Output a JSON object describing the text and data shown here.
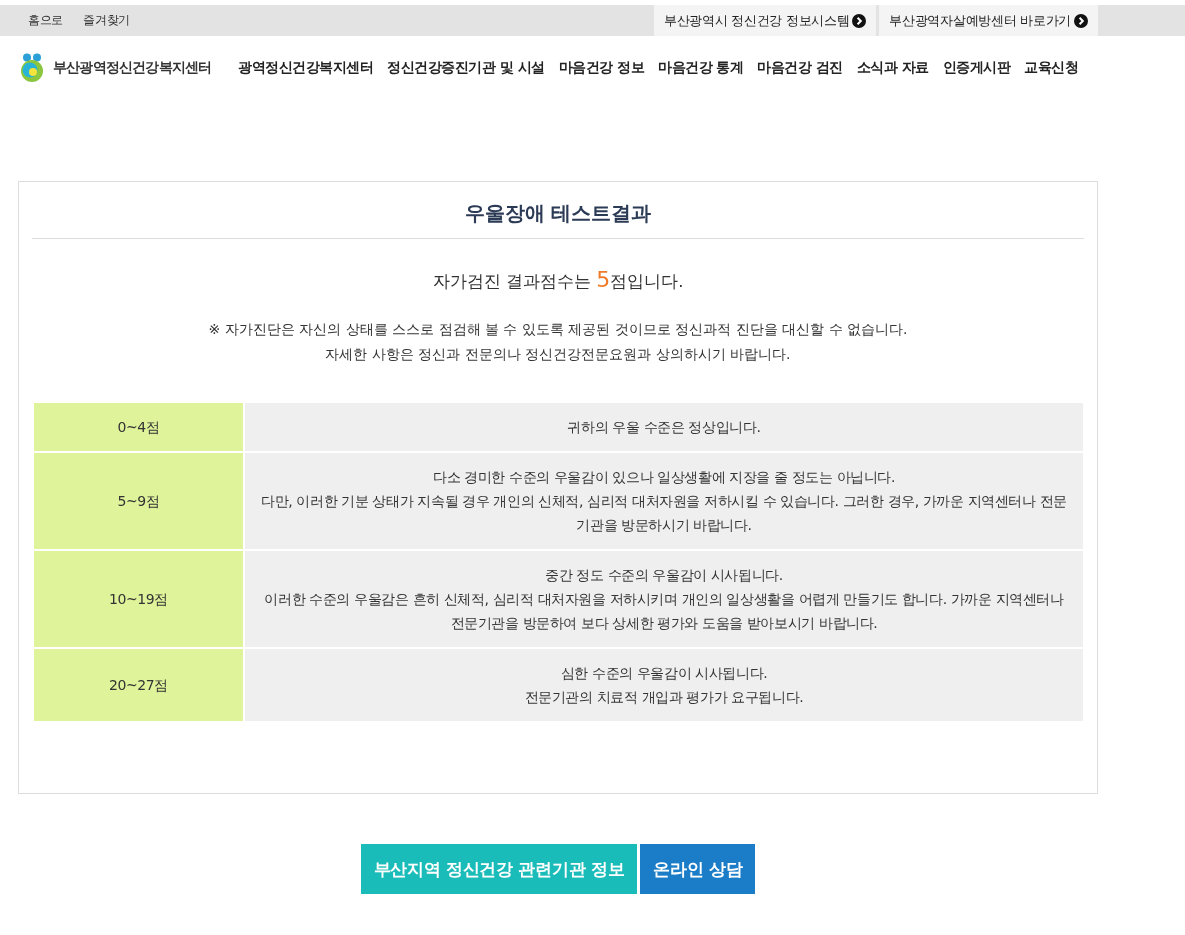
{
  "top_bar": {
    "links": [
      "홈으로",
      "즐겨찾기"
    ],
    "shortcuts": [
      "부산광역시 정신건강 정보시스템",
      "부산광역자살예방센터 바로가기"
    ]
  },
  "header": {
    "site_title": "부산광역정신건강복지센터",
    "nav": [
      "광역정신건강복지센터",
      "정신건강증진기관 및 시설",
      "마음건강 정보",
      "마음건강 통계",
      "마음건강 검진",
      "소식과 자료",
      "인증게시판",
      "교육신청"
    ]
  },
  "result": {
    "title": "우울장애 테스트결과",
    "score_sentence": {
      "before": "자가검진 결과점수는 ",
      "score": "5",
      "after": "점입니다."
    },
    "notes": [
      "※ 자가진단은 자신의 상태를 스스로 점검해 볼 수 있도록 제공된 것이므로 정신과적 진단을 대신할 수 없습니다.",
      "자세한 사항은 정신과 전문의나 정신건강전문요원과 상의하시기 바랍니다."
    ],
    "table": {
      "rows": [
        {
          "range": "0~4점",
          "lines": [
            "귀하의 우울 수준은 정상입니다."
          ]
        },
        {
          "range": "5~9점",
          "lines": [
            "다소 경미한 수준의 우울감이 있으나 일상생활에 지장을 줄 정도는 아닙니다.",
            "다만, 이러한 기분 상태가 지속될 경우 개인의 신체적, 심리적 대처자원을 저하시킬 수 있습니다. 그러한 경우, 가까운 지역센터나 전문기관을 방문하시기 바랍니다."
          ]
        },
        {
          "range": "10~19점",
          "lines": [
            "중간 정도 수준의 우울감이 시사됩니다.",
            "이러한 수준의 우울감은 흔히 신체적, 심리적 대처자원을 저하시키며 개인의 일상생활을 어렵게 만들기도 합니다. 가까운 지역센터나 전문기관을 방문하여 보다 상세한 평가와 도움을 받아보시기 바랍니다."
          ]
        },
        {
          "range": "20~27점",
          "lines": [
            "심한 수준의 우울감이 시사됩니다.",
            "전문기관의 치료적 개입과 평가가 요구됩니다."
          ]
        }
      ]
    }
  },
  "buttons": [
    {
      "label": "부산지역 정신건강 관련기관 정보",
      "kind": "primary"
    },
    {
      "label": "온라인 상담",
      "kind": "secondary"
    }
  ]
}
